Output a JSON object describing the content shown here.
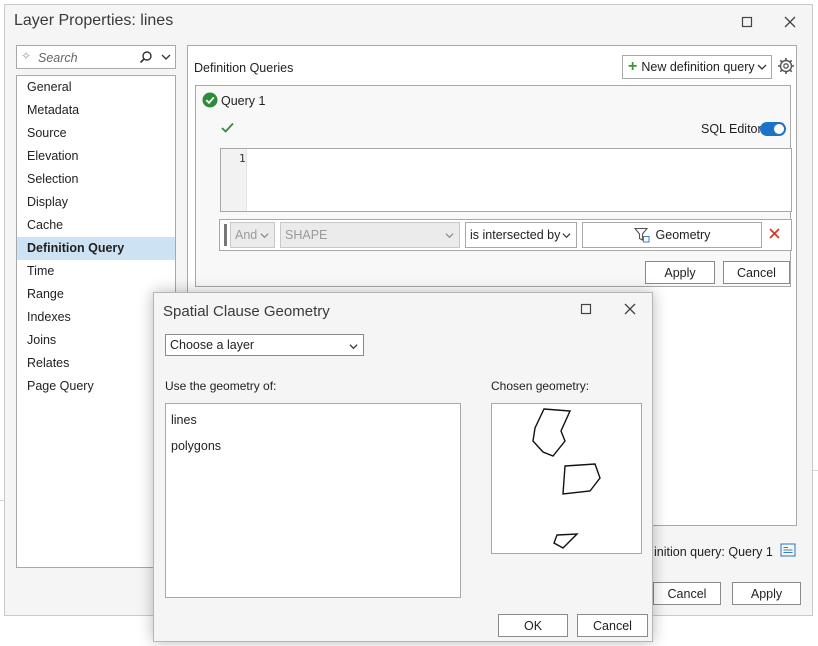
{
  "window": {
    "title": "Layer Properties: lines"
  },
  "sidebar": {
    "search_placeholder": "Search",
    "items": [
      {
        "label": "General"
      },
      {
        "label": "Metadata"
      },
      {
        "label": "Source"
      },
      {
        "label": "Elevation"
      },
      {
        "label": "Selection"
      },
      {
        "label": "Display"
      },
      {
        "label": "Cache"
      },
      {
        "label": "Definition Query",
        "selected": true
      },
      {
        "label": "Time"
      },
      {
        "label": "Range"
      },
      {
        "label": "Indexes"
      },
      {
        "label": "Joins"
      },
      {
        "label": "Relates"
      },
      {
        "label": "Page Query"
      }
    ]
  },
  "definition_queries": {
    "title": "Definition Queries",
    "new_button_label": "New definition query",
    "query": {
      "name": "Query 1",
      "sql_editor_label": "SQL Editor",
      "sql_editor_on": true,
      "line_number": "1",
      "clause": {
        "connector": "And",
        "field": "SHAPE",
        "operator": "is intersected by",
        "geometry_button_label": "Geometry"
      },
      "apply_label": "Apply",
      "cancel_label": "Cancel"
    },
    "active_status": "inition query: Query 1"
  },
  "footer": {
    "cancel_label": "Cancel",
    "apply_label": "Apply"
  },
  "dialog": {
    "title": "Spatial Clause Geometry",
    "layer_select_value": "Choose a layer",
    "use_geometry_label": "Use the geometry of:",
    "chosen_geometry_label": "Chosen geometry:",
    "layers": [
      "lines",
      "polygons"
    ],
    "ok_label": "OK",
    "cancel_label": "Cancel"
  },
  "colors": {
    "selected_nav_bg": "#cde3f4",
    "toggle_on": "#1a73c8",
    "check_green": "#2e8b3a",
    "remove_red": "#d13b2b"
  },
  "icons": [
    "search-icon",
    "chevron-down-icon",
    "gear-icon",
    "check-circle-icon",
    "checkmark-icon",
    "filter-geometry-icon",
    "close-icon",
    "maximize-icon",
    "report-icon"
  ]
}
